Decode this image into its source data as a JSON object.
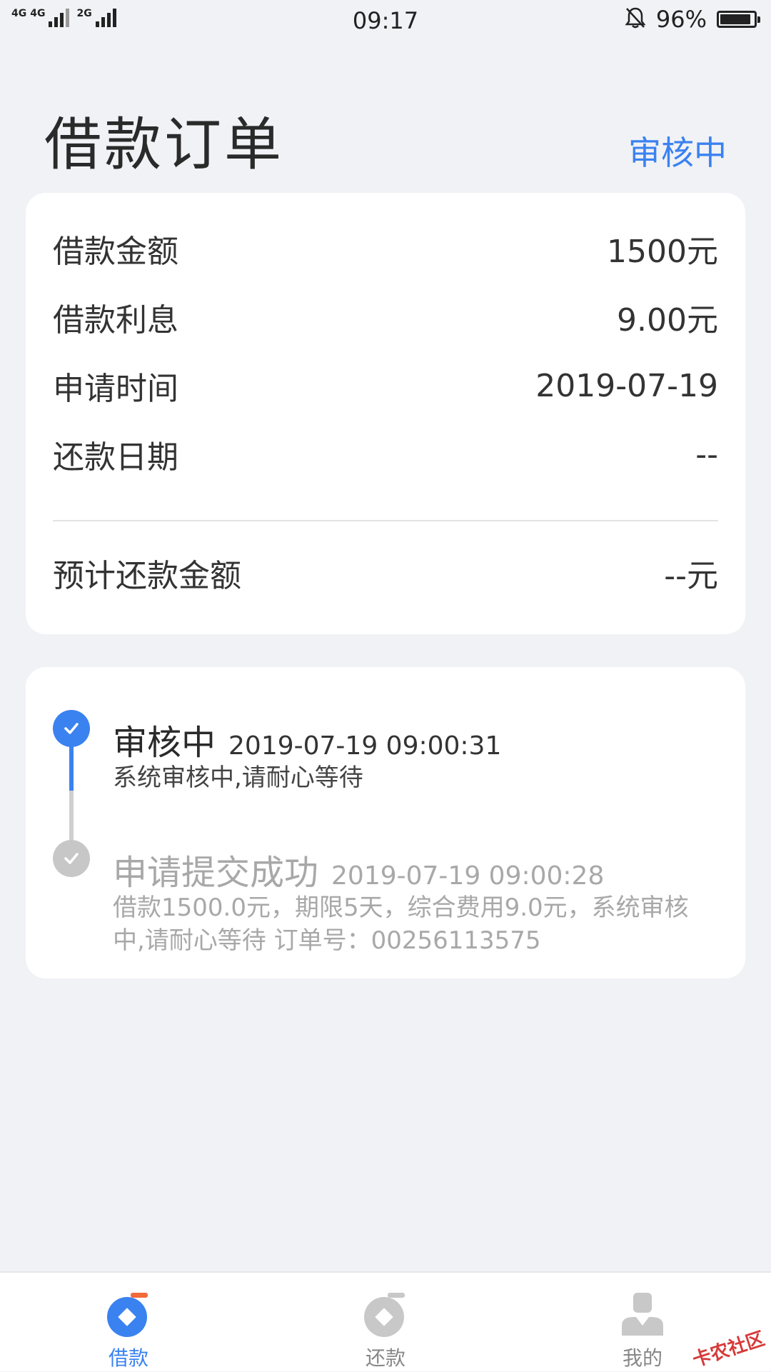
{
  "status_bar": {
    "network_1": "4G",
    "network_2": "4G",
    "network_3": "2G",
    "time": "09:17",
    "battery_percent": "96%",
    "battery_level": 0.96,
    "icons": [
      "signal-icon",
      "bell-muted-icon",
      "battery-icon"
    ]
  },
  "header": {
    "title": "借款订单",
    "status": "审核中"
  },
  "loan_details": {
    "rows": [
      {
        "label": "借款金额",
        "value": "1500元"
      },
      {
        "label": "借款利息",
        "value": "9.00元"
      },
      {
        "label": "申请时间",
        "value": "2019-07-19"
      },
      {
        "label": "还款日期",
        "value": "--"
      }
    ],
    "total": {
      "label": "预计还款金额",
      "value": "--元"
    }
  },
  "timeline": {
    "events": [
      {
        "title": "审核中",
        "time": "2019-07-19 09:00:31",
        "desc": "系统审核中,请耐心等待"
      },
      {
        "title": "申请提交成功",
        "time": "2019-07-19 09:00:28",
        "desc": "借款1500.0元，期限5天，综合费用9.0元，系统审核中,请耐心等待 订单号：00256113575"
      }
    ]
  },
  "bottom_nav": {
    "items": [
      {
        "label": "借款",
        "icon": "loan-icon"
      },
      {
        "label": "还款",
        "icon": "repay-icon"
      },
      {
        "label": "我的",
        "icon": "profile-icon"
      }
    ]
  },
  "watermark": "卡农社区",
  "colors": {
    "accent": "#3a82f0",
    "muted": "#a8a8a8",
    "background": "#f1f2f6"
  }
}
